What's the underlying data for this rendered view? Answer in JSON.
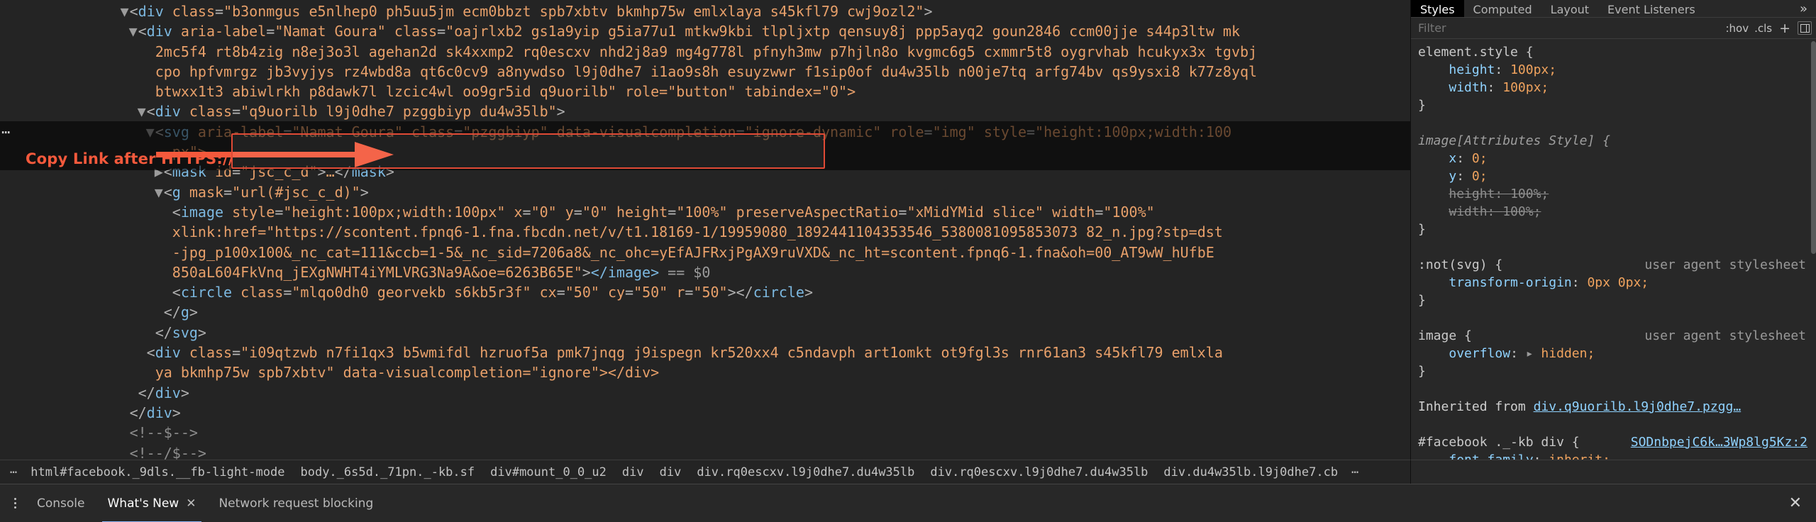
{
  "annotation": {
    "label": "Copy Link after HTTPS://",
    "arrow_color": "#f4593c",
    "highlight_color": "#e04a35",
    "left_dots": "⋯"
  },
  "dom_tree": {
    "lines": [
      {
        "indent": 14,
        "twisty": "▼",
        "content": "<div class=\"b3onmgus e5nlhep0 ph5uu5jm ecm0bbzt spb7xbtv bkmhp75w emlxlaya s45kfl79 cwj9ozl2\">"
      },
      {
        "indent": 15,
        "twisty": "▼",
        "content": "<div aria-label=\"Namat Goura\" class=\"oajrlxb2 gs1a9yip g5ia77u1 mtkw9kbi tlpljxtp qensuy8j ppp5ayq2 goun2846 ccm00jje s44p3ltw mk"
      },
      {
        "indent": 17,
        "twisty": "",
        "content": "2mc5f4 rt8b4zig n8ej3o3l agehan2d sk4xxmp2 rq0escxv nhd2j8a9 mg4g778l pfnyh3mw p7hjln8o kvgmc6g5 cxmmr5t8 oygrvhab hcukyx3x tgvbj"
      },
      {
        "indent": 17,
        "twisty": "",
        "content": "cpo hpfvmrgz jb3vyjys rz4wbd8a qt6c0cv9 a8nywdso l9j0dhe7 i1ao9s8h esuyzwwr f1sip0of du4w35lb n00je7tq arfg74bv qs9ysxi8 k77z8yql"
      },
      {
        "indent": 17,
        "twisty": "",
        "content": "btwxx1t3 abiwlrkh p8dawk7l lzcic4wl oo9gr5id q9uorilb\" role=\"button\" tabindex=\"0\">"
      },
      {
        "indent": 16,
        "twisty": "▼",
        "content": "<div class=\"q9uorilb l9j0dhe7 pzggbiyp du4w35lb\">"
      },
      {
        "indent": 17,
        "twisty": "▼",
        "content": "<svg aria-label=\"Namat Goura\" class=\"pzggbiyp\" data-visualcompletion=\"ignore-dynamic\" role=\"img\" style=\"height:100px;width:100"
      },
      {
        "indent": 19,
        "twisty": "",
        "content": "px\">"
      },
      {
        "indent": 18,
        "twisty": "▶",
        "content": "<mask id=\"jsc_c_d\">…</mask>"
      },
      {
        "indent": 18,
        "twisty": "▼",
        "content": "<g mask=\"url(#jsc_c_d)\">"
      }
    ],
    "image_line": {
      "prefix": "<image style=\"height:100px;width:100px\" x=\"0\" y=\"0\" height=\"100%\" preserveAspectRatio=\"xMidYMid slice\" width=\"100%\"",
      "highlight_lines": [
        "xlink:href=\"https://scontent.fpnq6-1.fna.fbcdn.net/v/t1.18169-1/19959080_1892441104353546_5380081095853073 82_n.jpg?stp=dst",
        "-jpg_p100x100&_nc_cat=111&ccb=1-5&_nc_sid=7206a8&_nc_ohc=yEfAJFRxjPgAX9ruVXD&_nc_ht=scontent.fpnq6-1.fna&oh=00_AT9wW_hUfbE",
        "850aL604FkVnq_jEXgNWHT4iYMLVRG3Na9A&oe=6263B65E\""
      ],
      "suffix": "></image> == $0"
    },
    "lines_after": [
      {
        "indent": 19,
        "twisty": "",
        "content": "<circle class=\"mlqo0dh0 georvekb s6kb5r3f\" cx=\"50\" cy=\"50\" r=\"50\"></circle>"
      },
      {
        "indent": 18,
        "twisty": "",
        "content": "</g>"
      },
      {
        "indent": 17,
        "twisty": "",
        "content": "</svg>"
      },
      {
        "indent": 16,
        "twisty": "",
        "content": "<div class=\"i09qtzwb n7fi1qx3 b5wmifdl hzruof5a pmk7jnqg j9ispegn kr520xx4 c5ndavph art1omkt ot9fgl3s rnr61an3 s45kfl79 emlxla"
      },
      {
        "indent": 17,
        "twisty": "",
        "content": "ya bkmhp75w spb7xbtv\" data-visualcompletion=\"ignore\"></div>"
      },
      {
        "indent": 15,
        "twisty": "",
        "content": "</div>"
      },
      {
        "indent": 14,
        "twisty": "",
        "content": "</div>"
      },
      {
        "indent": 14,
        "twisty": "",
        "content": "<!--$-->"
      },
      {
        "indent": 14,
        "twisty": "",
        "content": "<!--/$-->"
      }
    ]
  },
  "breadcrumb": {
    "items": [
      "⋯",
      "html#facebook._9dls.__fb-light-mode",
      "body._6s5d._71pn._-kb.sf",
      "div#mount_0_0_u2",
      "div",
      "div",
      "div.rq0escxv.l9j0dhe7.du4w35lb",
      "div.rq0escxv.l9j0dhe7.du4w35lb",
      "div.du4w35lb.l9j0dhe7.cb",
      "⋯"
    ]
  },
  "styles_panel": {
    "tabs": [
      {
        "label": "Styles",
        "active": true
      },
      {
        "label": "Computed",
        "active": false
      },
      {
        "label": "Layout",
        "active": false
      },
      {
        "label": "Event Listeners",
        "active": false
      }
    ],
    "more_icon": "»",
    "filter": {
      "placeholder": "Filter",
      "hov_label": ":hov",
      "cls_label": ".cls",
      "plus_icon": "+",
      "box_icon": "▣"
    },
    "rules": [
      {
        "type": "selector",
        "text": "element.style {"
      },
      {
        "type": "decl",
        "prop": "height",
        "value": "100px;"
      },
      {
        "type": "decl",
        "prop": "width",
        "value": "100px;"
      },
      {
        "type": "close",
        "text": "}"
      },
      {
        "type": "blank",
        "text": ""
      },
      {
        "type": "selector-italic",
        "text": "image[Attributes Style] {"
      },
      {
        "type": "decl",
        "prop": "x",
        "value": "0;"
      },
      {
        "type": "decl",
        "prop": "y",
        "value": "0;"
      },
      {
        "type": "decl-strike",
        "prop": "height",
        "value": "100%;"
      },
      {
        "type": "decl-strike",
        "prop": "width",
        "value": "100%;"
      },
      {
        "type": "close",
        "text": "}"
      },
      {
        "type": "blank",
        "text": ""
      },
      {
        "type": "selector-ua",
        "text": ":not(svg) {",
        "source": "user agent stylesheet"
      },
      {
        "type": "decl",
        "prop": "transform-origin",
        "value": "0px 0px;"
      },
      {
        "type": "close",
        "text": "}"
      },
      {
        "type": "blank",
        "text": ""
      },
      {
        "type": "selector-ua",
        "text": "image {",
        "source": "user agent stylesheet"
      },
      {
        "type": "decl-arrow",
        "prop": "overflow",
        "value": "hidden;"
      },
      {
        "type": "close",
        "text": "}"
      },
      {
        "type": "blank",
        "text": ""
      },
      {
        "type": "inherited",
        "text": "Inherited from ",
        "link": "div.q9uorilb.l9j0dhe7.pzgg…"
      },
      {
        "type": "blank",
        "text": ""
      },
      {
        "type": "selector-src",
        "text": "#facebook ._-kb div {",
        "source": "SODnbpejC6k…3Wp8lg5Kz:2"
      },
      {
        "type": "decl",
        "prop": "font-family",
        "value": "inherit;"
      },
      {
        "type": "close",
        "text": "}"
      }
    ]
  },
  "drawer": {
    "kebab_icon": "kebab-menu",
    "tabs": [
      {
        "label": "Console",
        "active": false,
        "closable": false
      },
      {
        "label": "What's New",
        "active": true,
        "closable": true
      },
      {
        "label": "Network request blocking",
        "active": false,
        "closable": false
      }
    ],
    "close_icon": "✕",
    "tab_close_icon": "✕"
  }
}
